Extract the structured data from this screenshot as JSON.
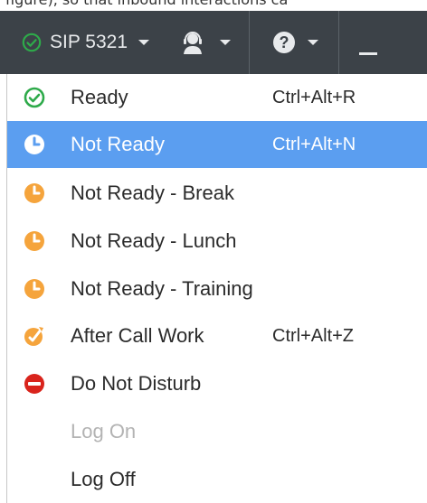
{
  "top_snippet": "figure), so that inbound interactions ca",
  "toolbar": {
    "status_label": "SIP 5321",
    "agent_icon": "headset-agent-icon",
    "help_label": "?",
    "minimize_icon": "minimize-icon"
  },
  "colors": {
    "toolbar_bg": "#3c4248",
    "ready_green": "#2eaa4a",
    "not_ready_orange": "#f5a43c",
    "selected_blue": "#5b9ef0",
    "dnd_red": "#d9241c"
  },
  "menu": {
    "items": [
      {
        "label": "Ready",
        "shortcut": "Ctrl+Alt+R",
        "icon": "ready-check-icon"
      },
      {
        "label": "Not Ready",
        "shortcut": "Ctrl+Alt+N",
        "icon": "not-ready-clock-icon",
        "selected": true
      },
      {
        "label": "Not Ready - Break",
        "shortcut": "",
        "icon": "not-ready-clock-icon"
      },
      {
        "label": "Not Ready - Lunch",
        "shortcut": "",
        "icon": "not-ready-clock-icon"
      },
      {
        "label": "Not Ready - Training",
        "shortcut": "",
        "icon": "not-ready-clock-icon"
      },
      {
        "label": "After Call Work",
        "shortcut": "Ctrl+Alt+Z",
        "icon": "after-call-work-icon"
      },
      {
        "label": "Do Not Disturb",
        "shortcut": "",
        "icon": "do-not-disturb-icon"
      },
      {
        "label": "Log On",
        "shortcut": "",
        "icon": "",
        "disabled": true
      },
      {
        "label": "Log Off",
        "shortcut": "",
        "icon": ""
      }
    ]
  }
}
